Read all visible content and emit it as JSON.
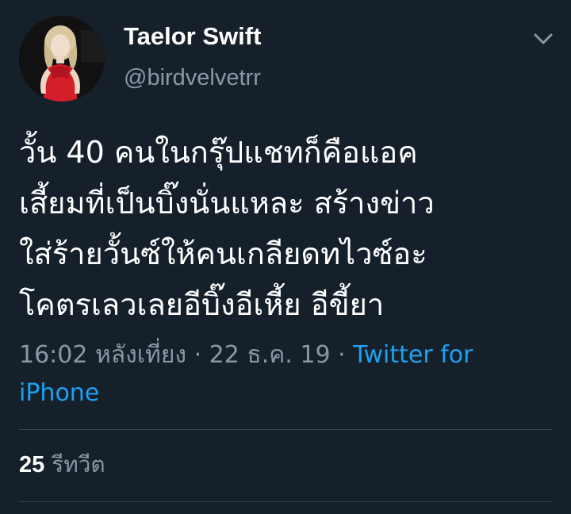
{
  "tweet": {
    "author": {
      "display_name": "Taelor Swift",
      "handle": "@birdvelvetrr"
    },
    "text_lines": [
      "วั้น 40 คนในกรุ๊ปแชทก็คือแอค",
      "เสี้ยมที่เป็นบิ๊งนั่นแหละ สร้างข่าว",
      "ใส่ร้ายวั้นซ์ให้คนเกลียดทไวซ์อะ",
      "โคตรเลวเลยอีบิ๊งอีเหี้ย อีขี้ยา"
    ],
    "meta": {
      "time": "16:02 หลังเที่ยง",
      "separator": " · ",
      "date": "22 ธ.ค. 19",
      "source_line1": "Twitter for",
      "source_line2": "iPhone"
    },
    "stats": {
      "retweet_count": "25",
      "retweet_label": "รีทวีต"
    },
    "icons": {
      "menu": "chevron-down-icon",
      "avatar": "avatar"
    },
    "colors": {
      "background": "#15202b",
      "text": "#ffffff",
      "secondary": "#8899a6",
      "link": "#1da1f2",
      "divider": "#38444d"
    }
  }
}
